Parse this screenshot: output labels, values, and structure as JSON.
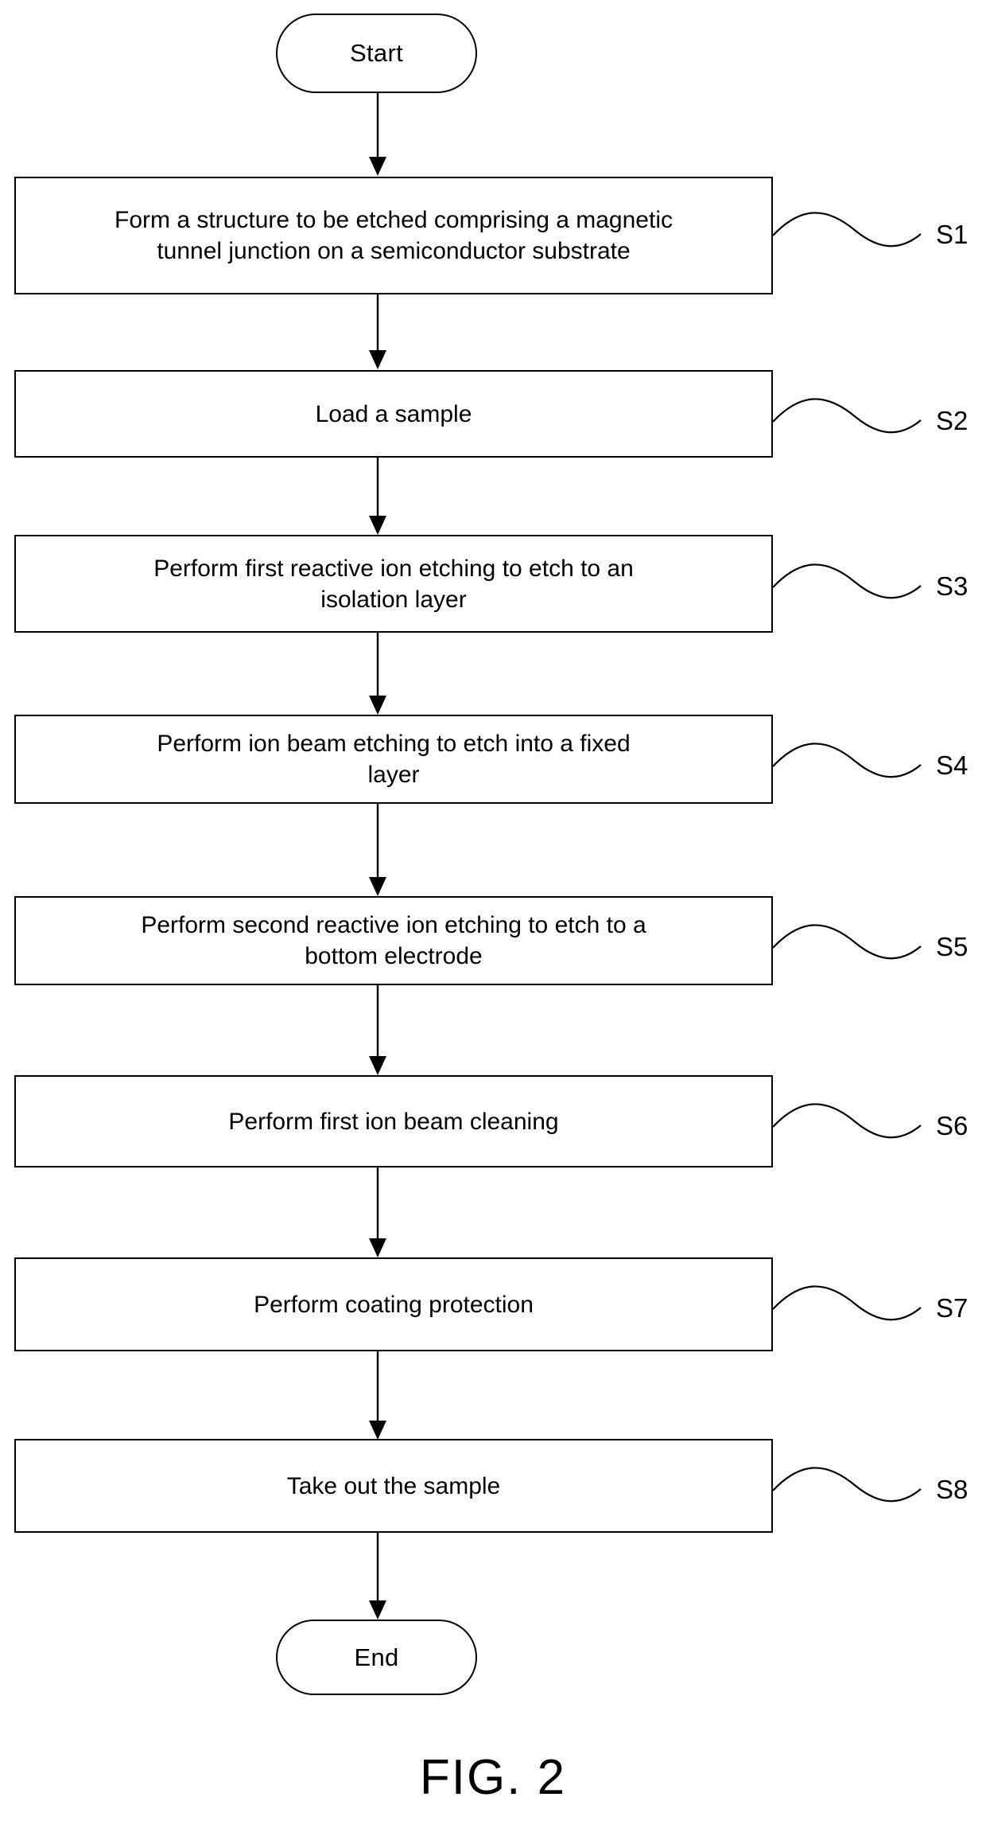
{
  "figure": {
    "caption": "FIG. 2",
    "type": "process-flowchart"
  },
  "chart_data": {
    "type": "table",
    "title": "FIG. 2",
    "description": "Flowchart of a magnetic tunnel junction etching process",
    "nodes": [
      {
        "id": "start",
        "shape": "terminal",
        "label": "Start"
      },
      {
        "id": "s1",
        "shape": "process",
        "label": "Form a structure to be etched comprising a magnetic\ntunnel junction on a semiconductor substrate",
        "step": "S1"
      },
      {
        "id": "s2",
        "shape": "process",
        "label": "Load a sample",
        "step": "S2"
      },
      {
        "id": "s3",
        "shape": "process",
        "label": "Perform first reactive ion etching to etch to an\nisolation layer",
        "step": "S3"
      },
      {
        "id": "s4",
        "shape": "process",
        "label": "Perform ion beam etching to etch into a fixed\nlayer",
        "step": "S4"
      },
      {
        "id": "s5",
        "shape": "process",
        "label": "Perform second reactive ion etching to etch to a\nbottom electrode",
        "step": "S5"
      },
      {
        "id": "s6",
        "shape": "process",
        "label": "Perform first ion beam cleaning",
        "step": "S6"
      },
      {
        "id": "s7",
        "shape": "process",
        "label": "Perform coating protection",
        "step": "S7"
      },
      {
        "id": "s8",
        "shape": "process",
        "label": "Take out the sample",
        "step": "S8"
      },
      {
        "id": "end",
        "shape": "terminal",
        "label": "End"
      }
    ],
    "edges": [
      {
        "from": "start",
        "to": "s1"
      },
      {
        "from": "s1",
        "to": "s2"
      },
      {
        "from": "s2",
        "to": "s3"
      },
      {
        "from": "s3",
        "to": "s4"
      },
      {
        "from": "s4",
        "to": "s5"
      },
      {
        "from": "s5",
        "to": "s6"
      },
      {
        "from": "s6",
        "to": "s7"
      },
      {
        "from": "s7",
        "to": "s8"
      },
      {
        "from": "s8",
        "to": "end"
      }
    ]
  },
  "start_node": {
    "label": "Start"
  },
  "end_node": {
    "label": "End"
  },
  "steps": [
    {
      "text": "Form a structure to be etched comprising a magnetic\ntunnel junction on a semiconductor substrate",
      "label": "S1"
    },
    {
      "text": "Load a sample",
      "label": "S2"
    },
    {
      "text": "Perform first reactive ion etching to etch to an\nisolation layer",
      "label": "S3"
    },
    {
      "text": "Perform ion beam etching to etch into a fixed\nlayer",
      "label": "S4"
    },
    {
      "text": "Perform second reactive ion etching to etch to a\nbottom electrode",
      "label": "S5"
    },
    {
      "text": "Perform first ion beam cleaning",
      "label": "S6"
    },
    {
      "text": "Perform coating protection",
      "label": "S7"
    },
    {
      "text": "Take out the sample",
      "label": "S8"
    }
  ],
  "colors": {
    "stroke": "#000000",
    "fill": "#ffffff",
    "text": "#000000"
  }
}
